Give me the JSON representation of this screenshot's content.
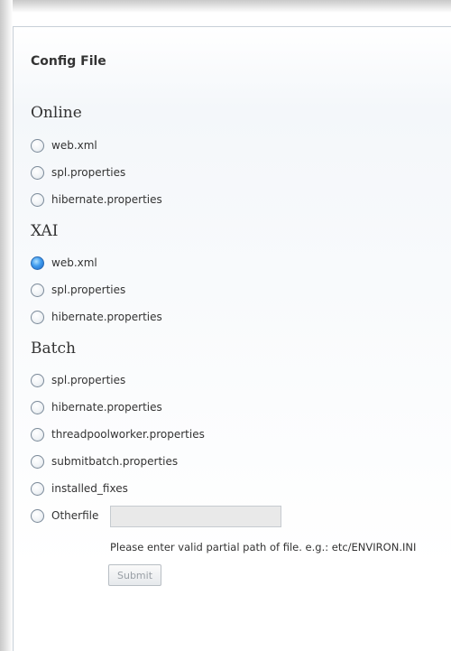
{
  "title": "Config File",
  "sections": {
    "online": {
      "heading": "Online",
      "options": [
        "web.xml",
        "spl.properties",
        "hibernate.properties"
      ]
    },
    "xai": {
      "heading": "XAI",
      "options": [
        "web.xml",
        "spl.properties",
        "hibernate.properties"
      ],
      "selected": "web.xml"
    },
    "batch": {
      "heading": "Batch",
      "options": [
        "spl.properties",
        "hibernate.properties",
        "threadpoolworker.properties",
        "submitbatch.properties",
        "installed_fixes",
        "Otherfile"
      ]
    }
  },
  "otherfile": {
    "value": "",
    "hint": "Please enter valid partial path of file. e.g.: etc/ENVIRON.INI"
  },
  "submit_label": "Submit",
  "colors": {
    "selected_radio": "#3f9bee",
    "text": "#333333",
    "disabled_text": "#9aa0a6"
  }
}
